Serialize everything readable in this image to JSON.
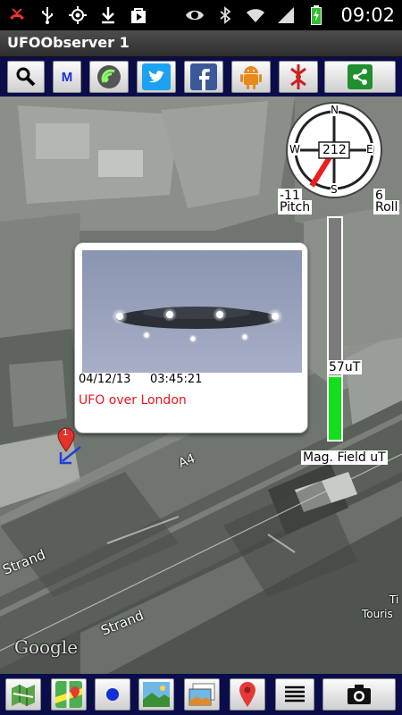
{
  "status_bar": {
    "time": "09:02",
    "icons": [
      "missed-call-icon",
      "usb-icon",
      "gps-icon",
      "download-icon",
      "play-store-icon",
      "eye-icon",
      "bluetooth-icon",
      "wifi-icon",
      "signal-icon",
      "battery-charging-icon"
    ]
  },
  "app": {
    "title": "UFOObserver 1"
  },
  "top_toolbar": {
    "buttons": [
      "search-icon",
      "map-type-m-icon",
      "share-radar-icon",
      "twitter-icon",
      "facebook-icon",
      "android-icon",
      "compass-pin-icon",
      "share-icon"
    ],
    "map_type_label": "M"
  },
  "compass": {
    "heading": "212",
    "north": "N",
    "south": "S",
    "east": "E",
    "west": "W",
    "pitch_value": "-11",
    "pitch_label": "Pitch",
    "roll_value": "6",
    "roll_label": "Roll"
  },
  "magnetic_field": {
    "value_label": "57uT",
    "label": "Mag. Field uT",
    "level_fraction": 0.29
  },
  "popup": {
    "date": "04/12/13",
    "time": "03:45:21",
    "title": "UFO over London"
  },
  "map": {
    "road_labels": [
      "A4",
      "Strand",
      "Strand"
    ],
    "partial_label_1": "Ti",
    "partial_label_2": "Touris",
    "attribution": "Google",
    "marker_number": "1"
  },
  "bottom_toolbar": {
    "buttons": [
      "map-layers-icon",
      "google-maps-icon",
      "blue-dot-icon",
      "landscape-photo-icon",
      "photo-stack-icon",
      "red-pin-icon",
      "list-icon",
      "camera-icon"
    ]
  }
}
